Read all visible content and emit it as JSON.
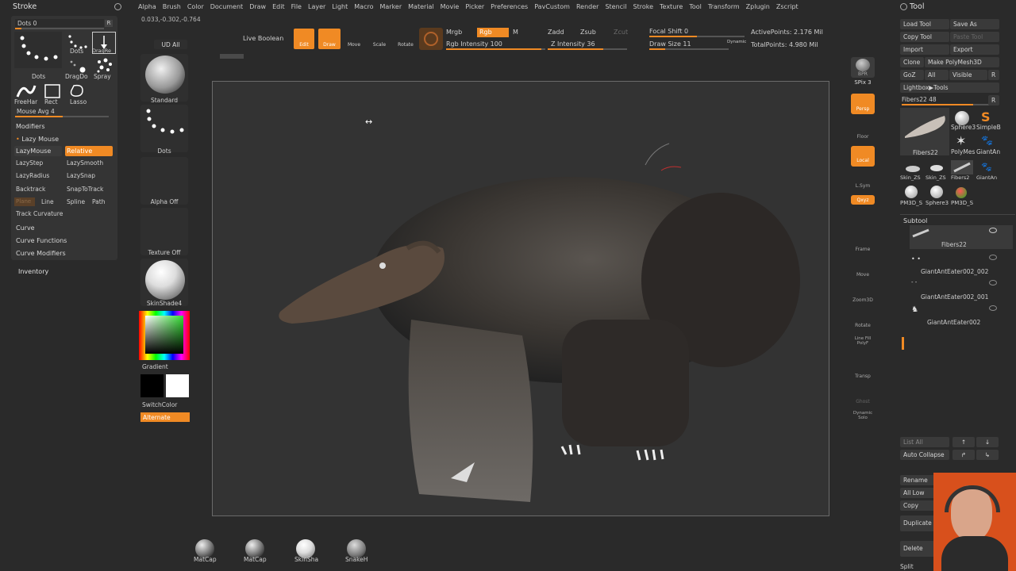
{
  "menu": [
    "Alpha",
    "Brush",
    "Color",
    "Document",
    "Draw",
    "Edit",
    "File",
    "Layer",
    "Light",
    "Macro",
    "Marker",
    "Material",
    "Movie",
    "Picker",
    "Preferences",
    "PavCustom",
    "Render",
    "Stencil",
    "Stroke",
    "Texture",
    "Tool",
    "Transform",
    "Zplugin",
    "Zscript"
  ],
  "coords": "0.033,-0.302,-0.764",
  "stroke_panel": {
    "title": "Stroke",
    "dots_label": "Dots 0",
    "r": "R",
    "brushes": [
      "Dots",
      "Dots",
      "DragRe",
      "DragDo",
      "Spray",
      "FreeHar",
      "Rect",
      "Lasso"
    ],
    "mouse_avg": "Mouse Avg 4",
    "modifiers": "Modifiers",
    "lazy_mouse": "Lazy Mouse",
    "lazymouse_btn": "LazyMouse",
    "relative_btn": "Relative",
    "lazystep": "LazyStep",
    "lazysmooth": "LazySmooth",
    "lazyradius": "LazyRadius",
    "lazysnap": "LazySnap",
    "backtrack": "Backtrack",
    "snaptotrack": "SnapToTrack",
    "plane": "Plane",
    "line": "Line",
    "spline": "Spline",
    "path": "Path",
    "track_curvature": "Track Curvature",
    "curve": "Curve",
    "curve_functions": "Curve Functions",
    "curve_modifiers": "Curve Modifiers",
    "inventory": "Inventory"
  },
  "shelf": {
    "ud_all": "UD All",
    "standard": "Standard",
    "dots": "Dots",
    "alpha_off": "Alpha Off",
    "texture_off": "Texture Off",
    "skinshade": "SkinShade4",
    "gradient": "Gradient",
    "switchcolor": "SwitchColor",
    "alternate": "Alternate"
  },
  "toolbar": {
    "live_boolean": "Live Boolean",
    "edit": "Edit",
    "draw": "Draw",
    "move": "Move",
    "scale": "Scale",
    "rotate": "Rotate",
    "mrgb": "Mrgb",
    "rgb": "Rgb",
    "m": "M",
    "rgb_intensity": "Rgb Intensity 100",
    "zadd": "Zadd",
    "zsub": "Zsub",
    "zcut": "Zcut",
    "z_intensity": "Z Intensity 36",
    "focal_shift": "Focal Shift 0",
    "draw_size": "Draw Size 11",
    "dynamic": "Dynamic",
    "active_points": "ActivePoints: 2.176 Mil",
    "total_points": "TotalPoints: 4.980 Mil"
  },
  "dock": [
    "BPR",
    "SPix 3",
    "Persp",
    "Floor",
    "Local",
    "L.Sym",
    "Qxyz",
    "Frame",
    "Move",
    "Zoom3D",
    "Rotate",
    "Line Fill PolyF",
    "Transp",
    "Ghost",
    "Dynamic Solo"
  ],
  "tool_panel": {
    "title": "Tool",
    "load_tool": "Load Tool",
    "save_as": "Save As",
    "copy_tool": "Copy Tool",
    "paste_tool": "Paste Tool",
    "import": "Import",
    "export": "Export",
    "clone": "Clone",
    "make_polymesh": "Make PolyMesh3D",
    "goz": "GoZ",
    "all": "All",
    "visible": "Visible",
    "r": "R",
    "lightbox_tools": "Lightbox▶Tools",
    "fibers_slider": "Fibers22  48",
    "thumbs": [
      "Fibers22",
      "Sphere3",
      "SimpleB",
      "PolyMes",
      "GiantAn",
      "Skin_ZS",
      "Skin_ZS",
      "Fibers2",
      "GiantAn",
      "PM3D_S",
      "Sphere3",
      "PM3D_S"
    ],
    "subtool": "Subtool",
    "subtools": [
      "Fibers22",
      "GiantAntEater002_002",
      "GiantAntEater002_001",
      "GiantAntEater002"
    ],
    "list_all": "List All",
    "auto_collapse": "Auto Collapse",
    "rename": "Rename",
    "all_low": "All Low",
    "copy": "Copy",
    "duplicate": "Duplicate",
    "delete": "Delete",
    "split": "Split"
  },
  "materials": [
    "MatCap",
    "MatCap",
    "SkinSha",
    "SnakeH"
  ],
  "colors": {
    "accent": "#f08a24",
    "bg": "#2a2a2a",
    "canvas": "#333333"
  }
}
